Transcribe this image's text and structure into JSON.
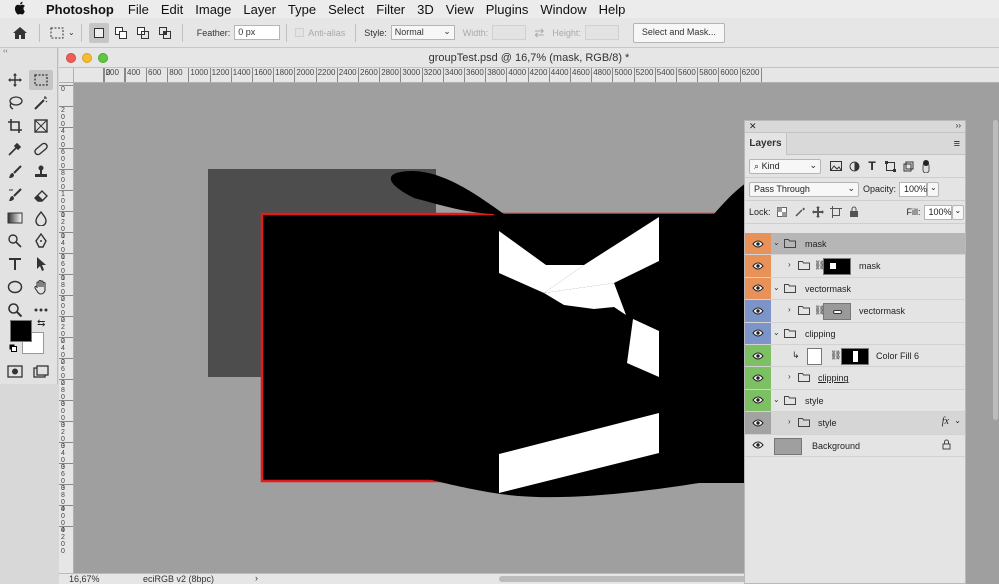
{
  "menubar": {
    "app": "Photoshop",
    "items": [
      "File",
      "Edit",
      "Image",
      "Layer",
      "Type",
      "Select",
      "Filter",
      "3D",
      "View",
      "Plugins",
      "Window",
      "Help"
    ]
  },
  "options": {
    "feather_label": "Feather:",
    "feather_value": "0 px",
    "antialias_label": "Anti-alias",
    "style_label": "Style:",
    "style_value": "Normal",
    "width_label": "Width:",
    "height_label": "Height:",
    "select_mask_label": "Select and Mask..."
  },
  "document": {
    "title": "groupTest.psd @ 16,7% (mask, RGB/8) *",
    "zoom": "16,67%",
    "profile": "eciRGB v2 (8bpc)",
    "ruler_ticks": [
      "0",
      "200",
      "400",
      "600",
      "800",
      "1000",
      "1200",
      "1400",
      "1600",
      "1800",
      "2000",
      "2200",
      "2400",
      "2600",
      "2800",
      "3000",
      "3200",
      "3400",
      "3600",
      "3800",
      "4000",
      "4200",
      "4400",
      "4600",
      "4800",
      "5000",
      "5200",
      "5400",
      "5600",
      "5800",
      "6000",
      "6200"
    ],
    "vruler_ticks": [
      "0",
      "2 0 0",
      "4 0 0",
      "6 0 0",
      "8 0 0",
      "1 0 0 0",
      "1 2 0 0",
      "1 4 0 0",
      "1 6 0 0",
      "1 8 0 0",
      "2 0 0 0",
      "2 2 0 0",
      "2 4 0 0",
      "2 6 0 0",
      "2 8 0 0",
      "3 0 0 0",
      "3 2 0 0",
      "3 4 0 0",
      "3 6 0 0",
      "3 8 0 0",
      "4 0 0 0",
      "4 2 0 0"
    ]
  },
  "layers_panel": {
    "tab": "Layers",
    "filter_kind": "Kind",
    "blend_mode": "Pass Through",
    "opacity_label": "Opacity:",
    "opacity_value": "100%",
    "lock_label": "Lock:",
    "fill_label": "Fill:",
    "fill_value": "100%",
    "rows": [
      {
        "name": "mask",
        "type": "group",
        "color": "#e8925a",
        "selected": true
      },
      {
        "name": "mask",
        "type": "smart-group",
        "color": "#e8925a"
      },
      {
        "name": "vectormask",
        "type": "group",
        "color": "#e8925a"
      },
      {
        "name": "vectormask",
        "type": "smart-group",
        "color": "#7d94c9"
      },
      {
        "name": "clipping",
        "type": "group",
        "color": "#7d94c9"
      },
      {
        "name": "Color Fill 6",
        "type": "fill",
        "color": "#7cc063"
      },
      {
        "name": "clipping",
        "type": "clipped-group",
        "color": "#7cc063"
      },
      {
        "name": "style",
        "type": "group",
        "color": "#7cc063"
      },
      {
        "name": "style",
        "type": "fx-group",
        "color": "#a3a3a3",
        "fx": "fx"
      },
      {
        "name": "Background",
        "type": "background",
        "color": "#e4e4e4"
      }
    ]
  }
}
